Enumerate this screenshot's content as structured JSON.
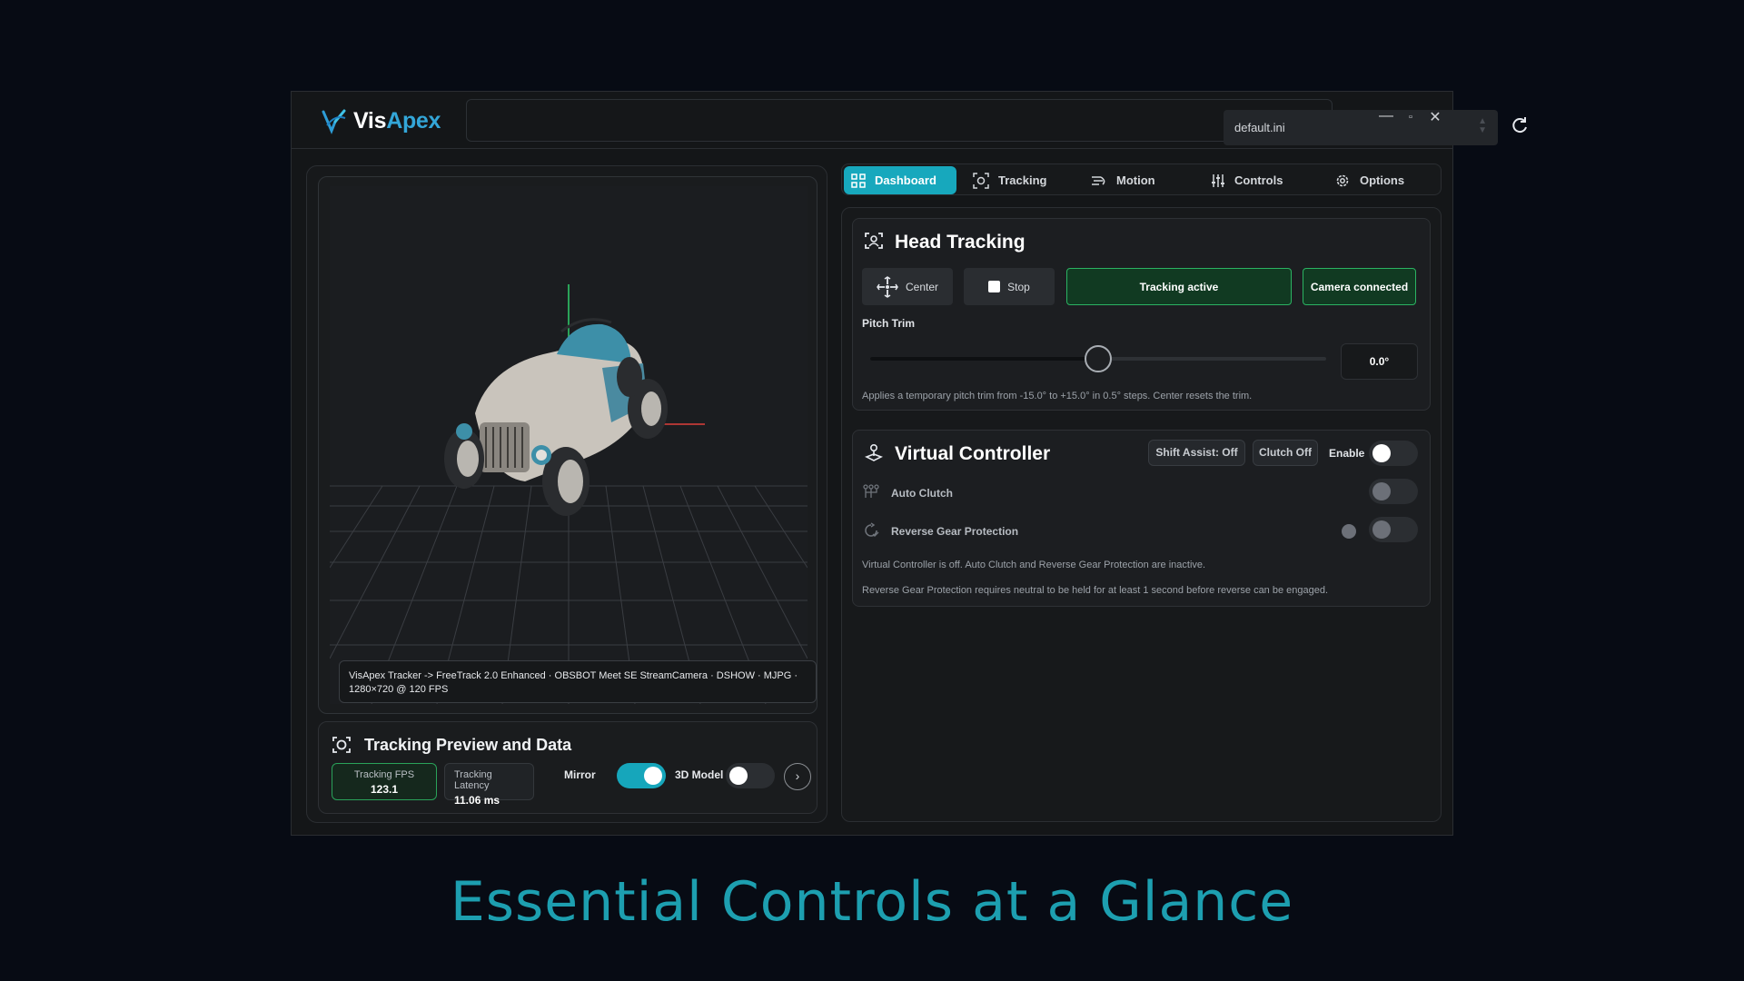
{
  "app": {
    "logo_prefix": "Vis",
    "logo_suffix": "Apex",
    "profile": "default.ini",
    "brand_color": "#33a6d8",
    "accent_color": "#17a8bd",
    "active_green": "#2bb362"
  },
  "viewport": {
    "status_line1": "VisApex Tracker -> FreeTrack 2.0 Enhanced · OBSBOT Meet SE StreamCamera · DSHOW · MJPG ·",
    "status_line2": "1280×720 @ 120 FPS"
  },
  "preview": {
    "title": "Tracking Preview and Data",
    "fps_label": "Tracking FPS",
    "fps_value": "123.1",
    "latency_label": "Tracking Latency",
    "latency_value": "11.06 ms",
    "mirror_label": "Mirror",
    "mirror_on": true,
    "model_label": "3D Model",
    "model_on": false
  },
  "tabs": [
    {
      "label": "Dashboard",
      "icon": "dashboard-icon",
      "active": true
    },
    {
      "label": "Tracking",
      "icon": "tracking-icon",
      "active": false
    },
    {
      "label": "Motion",
      "icon": "motion-icon",
      "active": false
    },
    {
      "label": "Controls",
      "icon": "sliders-icon",
      "active": false
    },
    {
      "label": "Options",
      "icon": "gear-icon",
      "active": false
    }
  ],
  "head_tracking": {
    "title": "Head Tracking",
    "center_label": "Center",
    "stop_label": "Stop",
    "tracking_status": "Tracking active",
    "camera_status": "Camera connected",
    "pitch_label": "Pitch Trim",
    "pitch_value": "0.0°",
    "pitch_fraction": 0.5,
    "pitch_note": "Applies a temporary pitch trim from -15.0° to +15.0° in 0.5° steps. Center resets the trim."
  },
  "virtual_controller": {
    "title": "Virtual Controller",
    "shift_assist": "Shift Assist: Off",
    "clutch": "Clutch Off",
    "enable_label": "Enable",
    "auto_clutch_label": "Auto Clutch",
    "reverse_label": "Reverse Gear Protection",
    "note1": "Virtual Controller is off. Auto Clutch and Reverse Gear Protection are inactive.",
    "note2": "Reverse Gear Protection requires neutral to be held for at least 1 second before reverse can be engaged."
  },
  "headline": "Essential Controls at a Glance"
}
